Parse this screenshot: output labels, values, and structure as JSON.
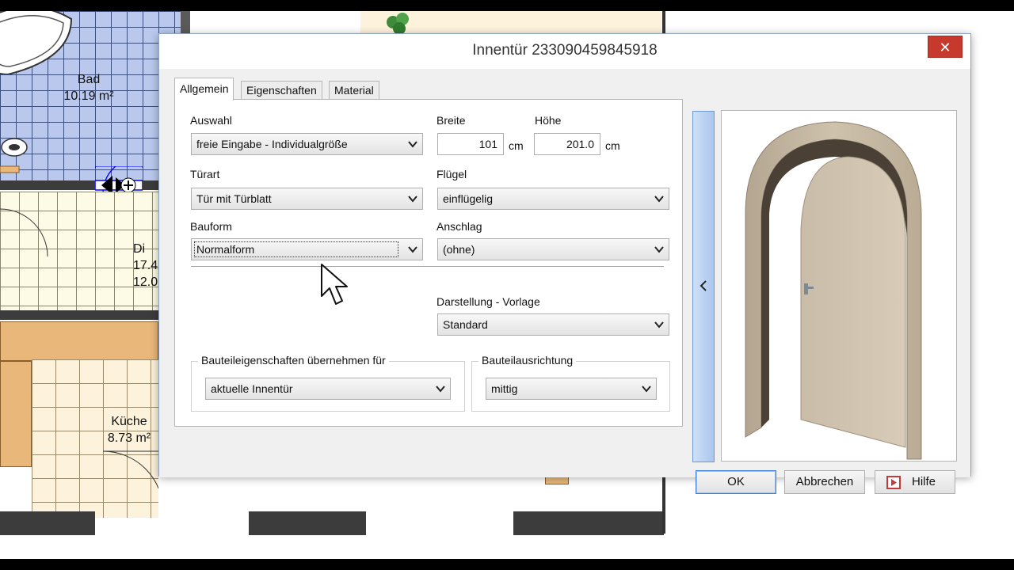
{
  "floor_plan": {
    "rooms": [
      {
        "name": "Bad",
        "area": "10.19 m²"
      },
      {
        "name": "Di",
        "area_lines": [
          "17.4",
          "12.0"
        ]
      },
      {
        "name": "Küche",
        "area": "8.73 m²"
      }
    ]
  },
  "dialog": {
    "title": "Innentür 233090459845918",
    "close_label": "✕",
    "tabs": [
      {
        "label": "Allgemein",
        "active": true
      },
      {
        "label": "Eigenschaften",
        "active": false
      },
      {
        "label": "Material",
        "active": false
      }
    ],
    "form": {
      "auswahl": {
        "label": "Auswahl",
        "value": "freie Eingabe - Individualgröße"
      },
      "breite": {
        "label": "Breite",
        "value": "101",
        "unit": "cm"
      },
      "hoehe": {
        "label": "Höhe",
        "value": "201.0",
        "unit": "cm"
      },
      "tuerart": {
        "label": "Türart",
        "value": "Tür mit Türblatt"
      },
      "fluegel": {
        "label": "Flügel",
        "value": "einflügelig"
      },
      "bauform": {
        "label": "Bauform",
        "value": "Normalform"
      },
      "anschlag": {
        "label": "Anschlag",
        "value": "(ohne)"
      },
      "darstellung": {
        "label": "Darstellung - Vorlage",
        "value": "Standard"
      },
      "bauteileigenschaften": {
        "label": "Bauteileigenschaften übernehmen für",
        "value": "aktuelle Innentür"
      },
      "bauteilausrichtung": {
        "label": "Bauteilausrichtung",
        "value": "mittig"
      }
    },
    "buttons": {
      "ok": "OK",
      "cancel": "Abbrechen",
      "help": "Hilfe"
    },
    "collapse_icon": "chevron-left-icon",
    "preview_icon": "arched-door-3d-preview"
  },
  "colors": {
    "close_red": "#c7392c",
    "accent_blue": "#3b7fd6",
    "bath_tile": "#b9c8ec",
    "door_frame": "#c4b59e"
  }
}
